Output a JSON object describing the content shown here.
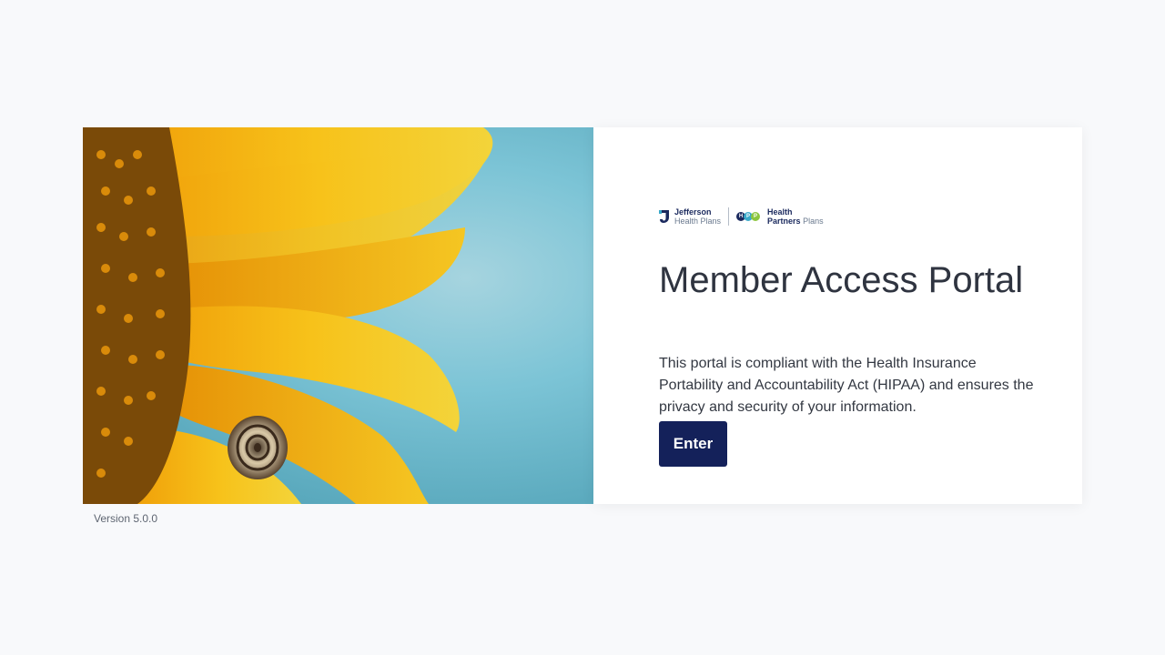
{
  "hero": {
    "image": "sunflower-with-snail"
  },
  "logos": {
    "jefferson": {
      "line1": "Jefferson",
      "line2": "Health Plans"
    },
    "hpp": {
      "dots": [
        "H",
        "P",
        "P"
      ],
      "line1": "Health",
      "line2a": "Partners",
      "line2b": "Plans"
    }
  },
  "card": {
    "title": "Member Access Portal",
    "description": "This portal is compliant with the Health Insurance Portability and Accountability Act (HIPAA) and ensures the privacy and security of your information.",
    "enter_label": "Enter"
  },
  "footer": {
    "version": "Version 5.0.0"
  },
  "colors": {
    "button": "#14215a",
    "page_bg": "#f8f9fb",
    "hpp_dot_1": "#1b2a5e",
    "hpp_dot_2": "#3aa9c9",
    "hpp_dot_3": "#8cc63f"
  }
}
